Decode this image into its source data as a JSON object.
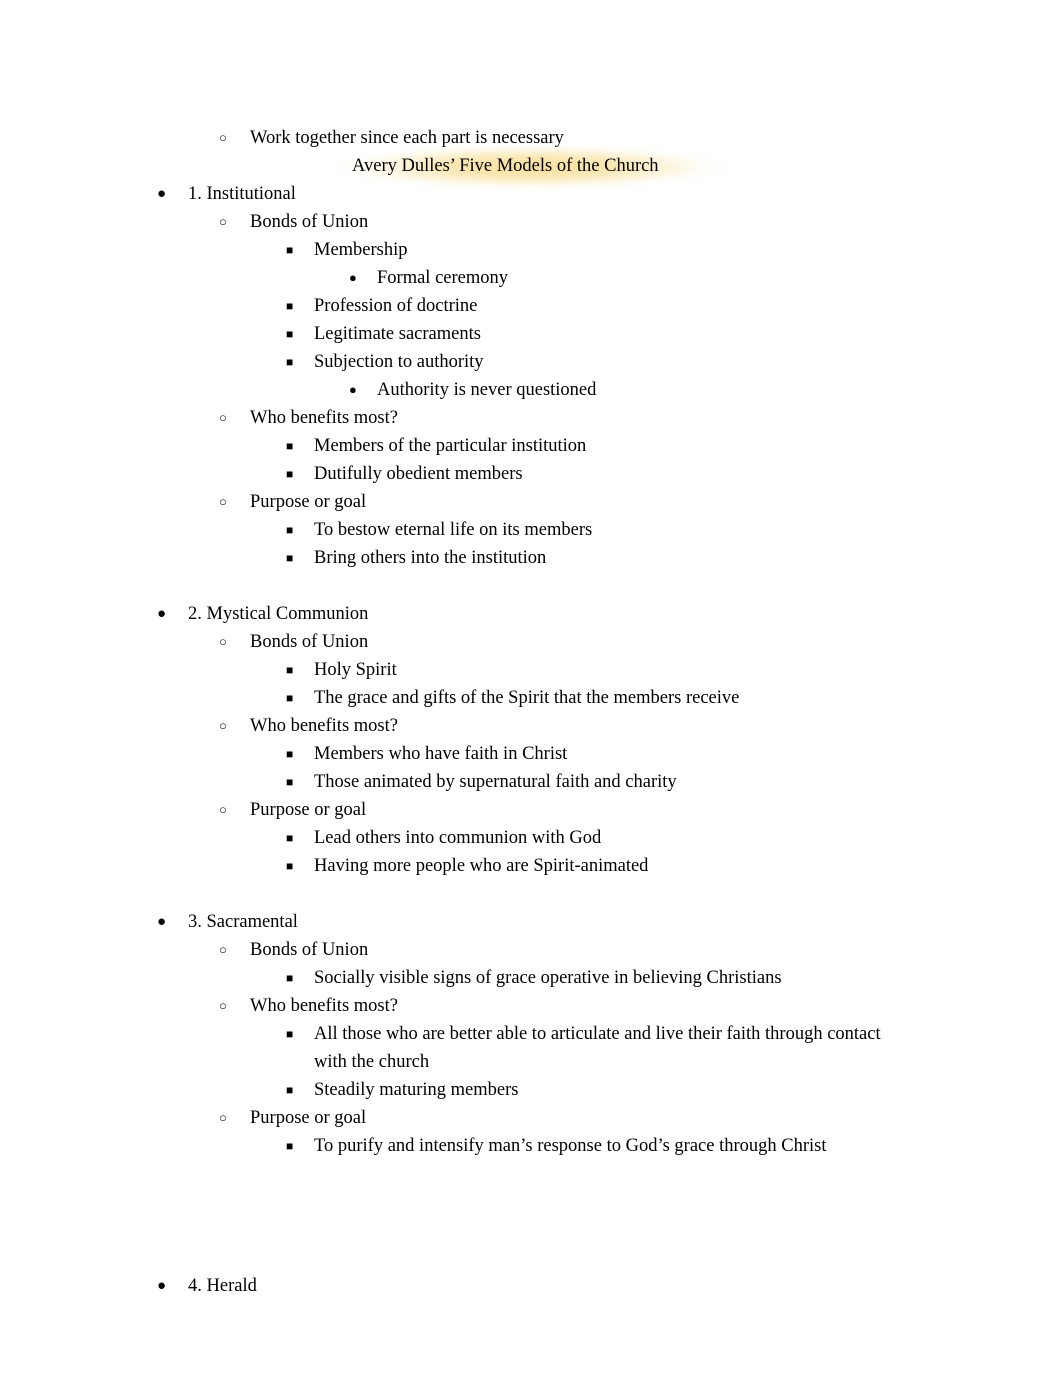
{
  "document": {
    "title_line": "Avery Dulles’ Five Models of the Church",
    "highlight_color": "#f8de9b",
    "text_color": "#000000",
    "background_color": "#ffffff"
  },
  "bullets": {
    "level1": "●",
    "level2": "○",
    "level3": "■",
    "level4": "●"
  },
  "lines": {
    "intro": "Work together since each part is necessary",
    "s1_heading": "1. Institutional",
    "s1_bonds": "Bonds of Union",
    "s1_membership": "Membership",
    "s1_formal_ceremony": "Formal ceremony",
    "s1_profession": "Profession of doctrine",
    "s1_sacraments": "Legitimate sacraments",
    "s1_subjection": "Subjection to authority",
    "s1_authority_never": "Authority is never questioned",
    "s1_who_benefits": "Who benefits most?",
    "s1_members_particular": "Members of the particular institution",
    "s1_dutifully": "Dutifully obedient members",
    "s1_purpose": "Purpose or goal",
    "s1_bestow": "To bestow eternal life on its members",
    "s1_bring_others": "Bring others into the institution",
    "s2_heading": "2. Mystical Communion",
    "s2_bonds": "Bonds of Union",
    "s2_holy_spirit": "Holy Spirit",
    "s2_grace_gifts": "The grace and gifts of the Spirit that the members receive",
    "s2_who_benefits": "Who benefits most?",
    "s2_members_faith": "Members who have faith in Christ",
    "s2_those_animated": "Those animated by supernatural faith and charity",
    "s2_purpose": "Purpose or goal",
    "s2_lead_others": "Lead others into communion with God",
    "s2_having_more": "Having more people who are Spirit-animated",
    "s3_heading": "3. Sacramental",
    "s3_bonds": "Bonds of Union",
    "s3_socially_visible": "Socially visible signs of grace operative in believing Christians",
    "s3_who_benefits": "Who benefits most?",
    "s3_all_those": "All those who are better able to articulate and live their faith through contact with the church",
    "s3_steadily": "Steadily maturing members",
    "s3_purpose": "Purpose or goal",
    "s3_to_purify": "To purify and intensify man’s response to God’s grace through Christ",
    "s4_heading": "4. Herald"
  }
}
